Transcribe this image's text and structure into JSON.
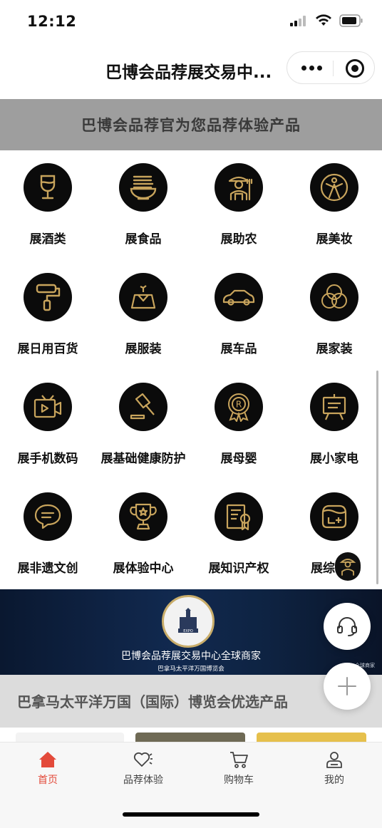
{
  "status_bar": {
    "time": "12:12"
  },
  "nav": {
    "title": "巴博会品荐展交易中..."
  },
  "strip": {
    "text": "巴博会品荐官为您品荐体验产品"
  },
  "categories": [
    {
      "label": "展酒类",
      "icon": "wine-glass-icon"
    },
    {
      "label": "展食品",
      "icon": "noodle-bowl-icon"
    },
    {
      "label": "展助农",
      "icon": "farmer-icon"
    },
    {
      "label": "展美妆",
      "icon": "beauty-figure-icon"
    },
    {
      "label": "展日用百货",
      "icon": "paint-roller-icon"
    },
    {
      "label": "展服装",
      "icon": "clothing-box-icon"
    },
    {
      "label": "展车品",
      "icon": "car-icon"
    },
    {
      "label": "展家装",
      "icon": "interlocking-circles-icon"
    },
    {
      "label": "展手机数码",
      "icon": "video-tv-icon"
    },
    {
      "label": "展基础健康防护",
      "icon": "gavel-icon"
    },
    {
      "label": "展母婴",
      "icon": "award-badge-icon"
    },
    {
      "label": "展小家电",
      "icon": "easel-screen-icon"
    },
    {
      "label": "展非遗文创",
      "icon": "chat-bubble-icon"
    },
    {
      "label": "展体验中心",
      "icon": "trophy-icon"
    },
    {
      "label": "展知识产权",
      "icon": "certificate-icon"
    },
    {
      "label": "展综",
      "icon": "calendar-plus-icon"
    }
  ],
  "expo_banner": {
    "emblem_text": "1915 PANAMA WORLD EXPOSITION",
    "emblem_word": "EXPO",
    "title": "巴博会品荐展交易中心全球商家",
    "subtitle": "巴拿马太平洋万国博览会",
    "corner": "全球商家"
  },
  "section_header": {
    "text": "巴拿马太平洋万国（国际）博览会优选产品"
  },
  "tabs": [
    {
      "label": "首页",
      "icon": "home-icon",
      "active": true
    },
    {
      "label": "品荐体验",
      "icon": "heart-icon",
      "active": false
    },
    {
      "label": "购物车",
      "icon": "cart-icon",
      "active": false
    },
    {
      "label": "我的",
      "icon": "profile-icon",
      "active": false
    }
  ],
  "colors": {
    "gold": "#c8a45c",
    "active_tab": "#e34a3a",
    "strip_bg": "#9e9e9e"
  }
}
